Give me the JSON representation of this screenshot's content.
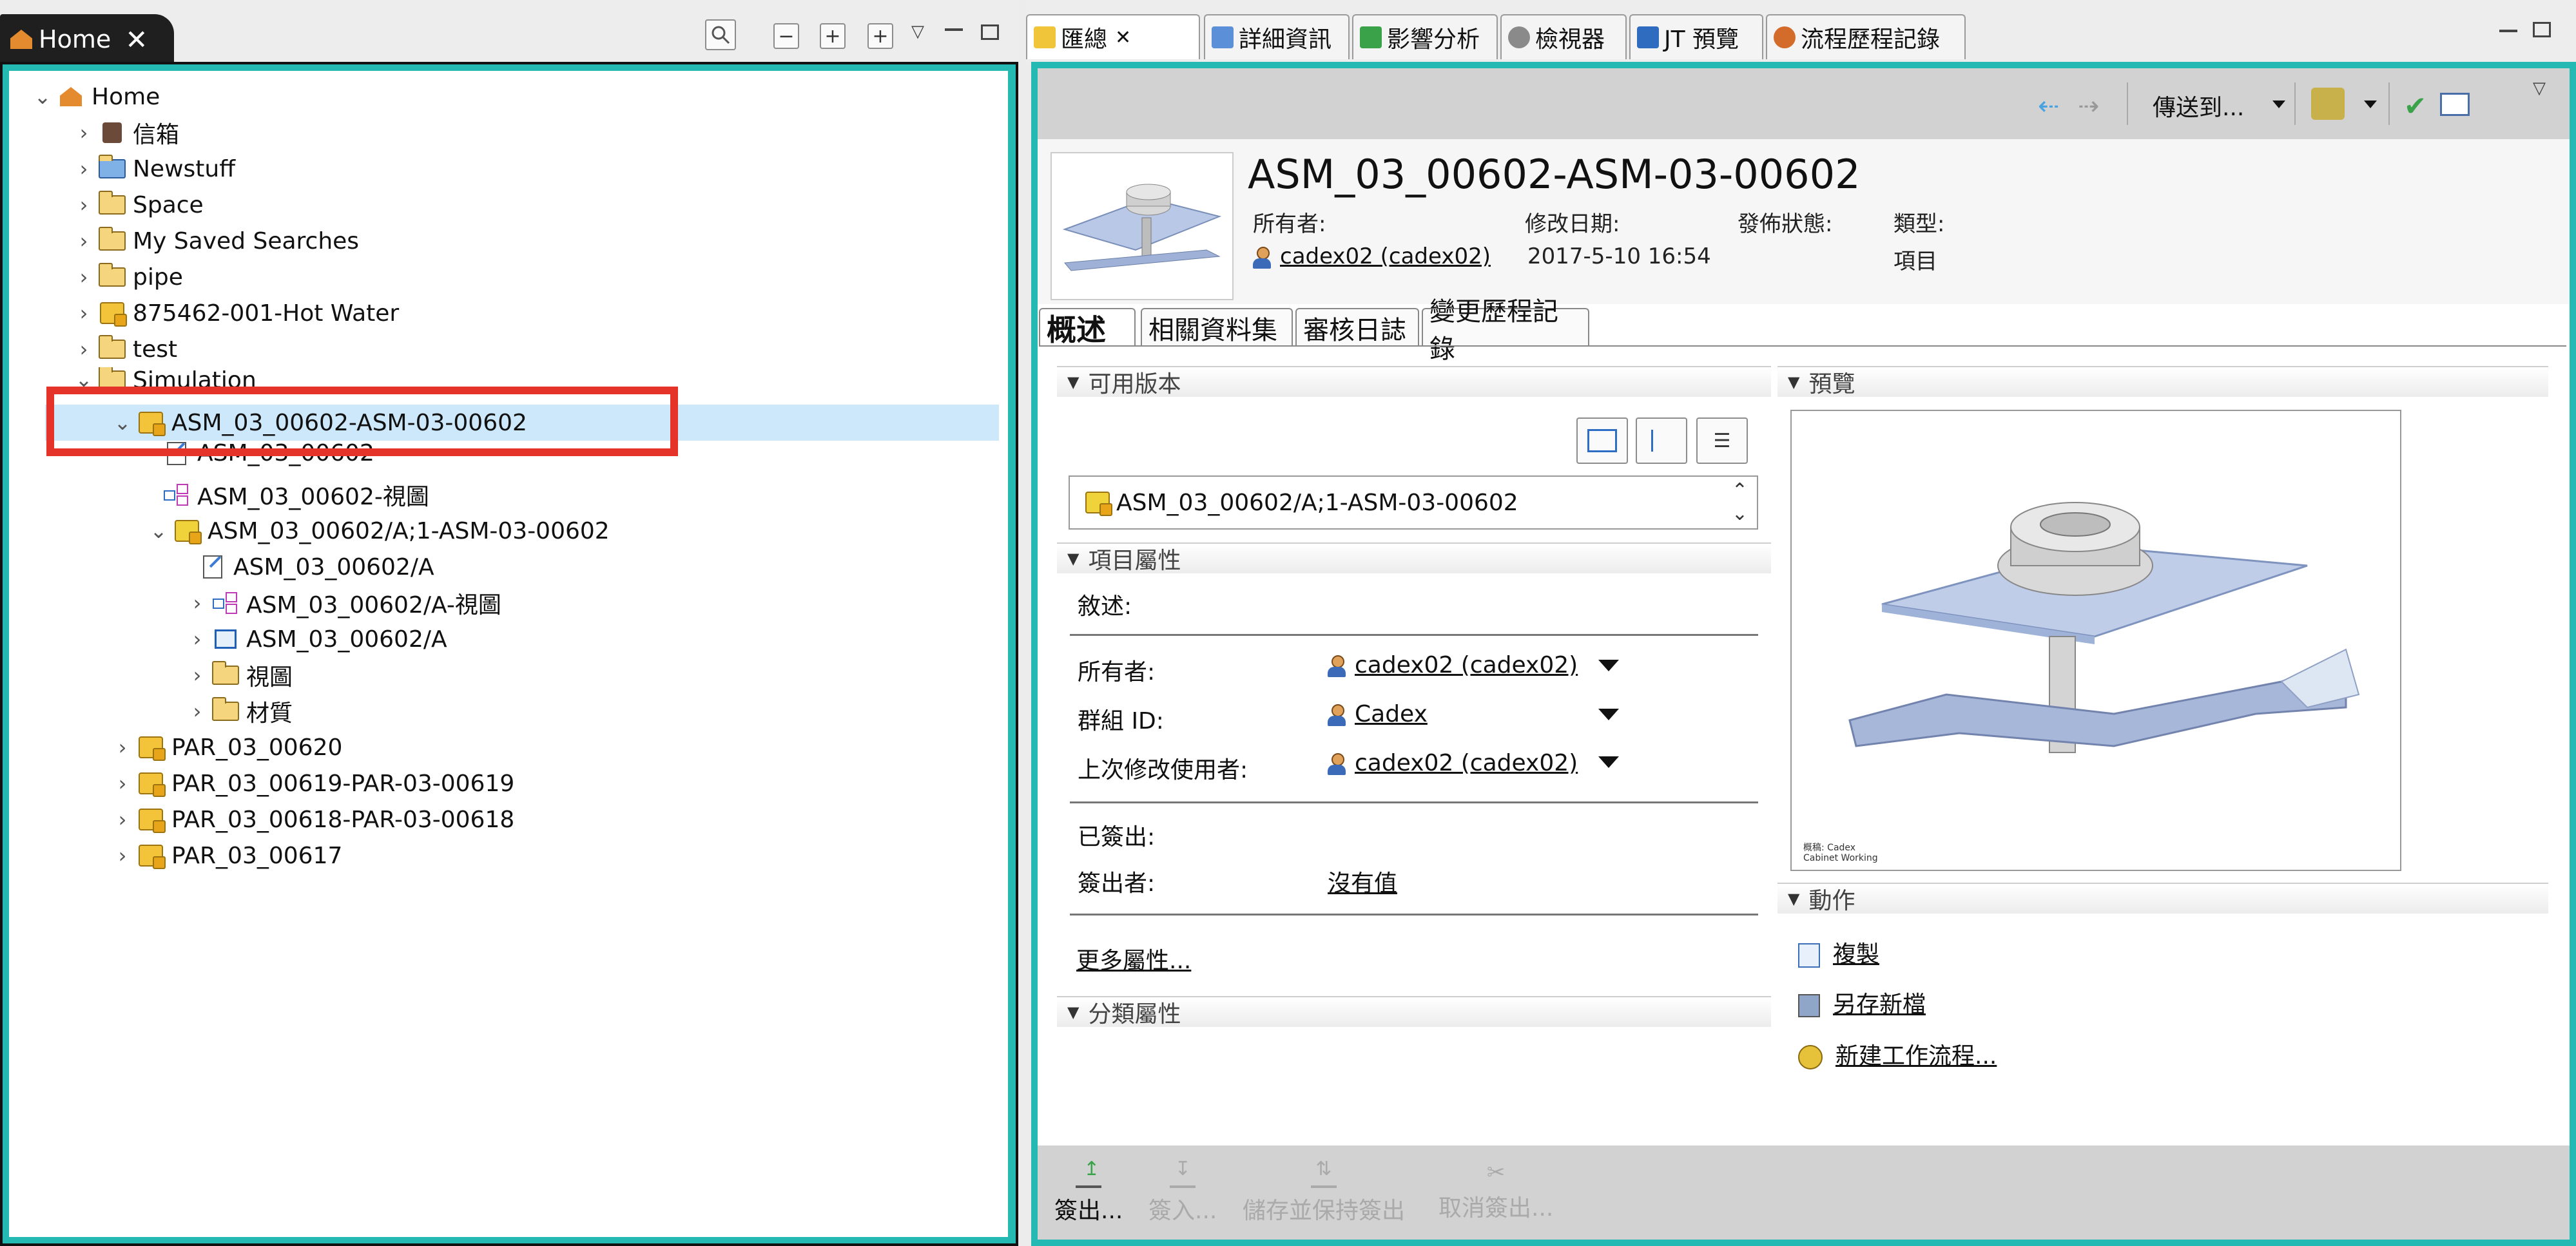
{
  "left_panel": {
    "tab_label": "Home",
    "tab_close": "✕",
    "tree": [
      {
        "label": "Home",
        "depth": 0,
        "expanded": true,
        "icon": "home-icon"
      },
      {
        "label": "信箱",
        "depth": 1,
        "icon": "mailbox-icon"
      },
      {
        "label": "Newstuff",
        "depth": 1,
        "icon": "newstuff-folder-icon"
      },
      {
        "label": "Space",
        "depth": 1,
        "icon": "folder-icon"
      },
      {
        "label": "My Saved Searches",
        "depth": 1,
        "icon": "folder-icon"
      },
      {
        "label": "pipe",
        "depth": 1,
        "icon": "folder-icon"
      },
      {
        "label": "875462-001-Hot Water",
        "depth": 1,
        "icon": "item-icon"
      },
      {
        "label": "test",
        "depth": 1,
        "icon": "folder-icon"
      },
      {
        "label": "Simulation",
        "depth": 1,
        "icon": "folder-icon"
      },
      {
        "label": "ASM_03_00602-ASM-03-00602",
        "depth": 2,
        "expanded": true,
        "selected": true,
        "icon": "item-icon"
      },
      {
        "label": "ASM_03_00602",
        "depth": 3,
        "icon": "document-icon"
      },
      {
        "label": "ASM_03_00602-視圖",
        "depth": 3,
        "icon": "view-icon"
      },
      {
        "label": "ASM_03_00602/A;1-ASM-03-00602",
        "depth": 3,
        "expanded": true,
        "icon": "item-revision-icon"
      },
      {
        "label": "ASM_03_00602/A",
        "depth": 4,
        "icon": "document-icon"
      },
      {
        "label": "ASM_03_00602/A-視圖",
        "depth": 4,
        "icon": "view-icon"
      },
      {
        "label": "ASM_03_00602/A",
        "depth": 4,
        "icon": "jt-dataset-icon"
      },
      {
        "label": "視圖",
        "depth": 4,
        "icon": "folder-icon"
      },
      {
        "label": "材質",
        "depth": 4,
        "icon": "folder-icon"
      },
      {
        "label": "PAR_03_00620",
        "depth": 2,
        "icon": "item-icon"
      },
      {
        "label": "PAR_03_00619-PAR-03-00619",
        "depth": 2,
        "icon": "item-icon"
      },
      {
        "label": "PAR_03_00618-PAR-03-00618",
        "depth": 2,
        "icon": "item-icon"
      },
      {
        "label": "PAR_03_00617",
        "depth": 2,
        "icon": "item-icon"
      }
    ]
  },
  "right_tabs": [
    {
      "label": "匯總",
      "icon": "summary-icon"
    },
    {
      "label": "詳細資訊",
      "icon": "details-icon"
    },
    {
      "label": "影響分析",
      "icon": "impact-icon"
    },
    {
      "label": "檢視器",
      "icon": "viewer-icon"
    },
    {
      "label": "JT 預覽",
      "icon": "jt-icon"
    },
    {
      "label": "流程歷程記錄",
      "icon": "process-history-icon"
    }
  ],
  "toolbar": {
    "send_to": "傳送到..."
  },
  "header": {
    "title": "ASM_03_00602-ASM-03-00602",
    "owner_label": "所有者:",
    "owner_value": "cadex02 (cadex02)",
    "modified_label": "修改日期:",
    "modified_value": "2017-5-10 16:54",
    "release_label": "發佈狀態:",
    "type_label": "類型:",
    "type_value": "項目"
  },
  "subtabs": [
    "概述",
    "相關資料集",
    "審核日誌",
    "變更歷程記錄"
  ],
  "available_revisions": {
    "title": "可用版本",
    "value": "ASM_03_00602/A;1-ASM-03-00602"
  },
  "item_properties": {
    "title": "項目屬性",
    "description_label": "敘述:",
    "owner_label": "所有者:",
    "owner_value": "cadex02 (cadex02)",
    "group_label": "群組 ID:",
    "group_value": "Cadex",
    "last_mod_label": "上次修改使用者:",
    "last_mod_value": "cadex02 (cadex02)",
    "checked_out_label": "已簽出:",
    "checked_out_by_label": "簽出者:",
    "checked_out_by_value": "沒有值",
    "more": "更多屬性..."
  },
  "classification": {
    "title": "分類屬性"
  },
  "preview": {
    "title": "預覽",
    "watermark": "概稿: Cadex\nCabinet Working"
  },
  "actions": {
    "title": "動作",
    "items": [
      "複製",
      "另存新檔",
      "新建工作流程..."
    ]
  },
  "bottom": {
    "checkout": "簽出...",
    "checkin": "簽入...",
    "save_keep": "儲存並保持簽出",
    "cancel_checkout": "取消簽出..."
  },
  "colors": {
    "accent": "#25b9b3",
    "highlight": "#e6332a",
    "selection": "#cde8fb"
  }
}
